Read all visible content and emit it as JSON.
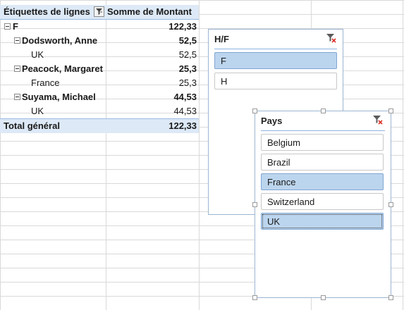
{
  "pivot": {
    "header": {
      "row_labels": "Étiquettes de lignes",
      "sum_label": "Somme de Montant"
    },
    "rows": [
      {
        "label": "F",
        "value": "122,33"
      },
      {
        "label": "Dodsworth, Anne",
        "value": "52,5"
      },
      {
        "label": "UK",
        "value": "52,5"
      },
      {
        "label": "Peacock, Margaret",
        "value": "25,3"
      },
      {
        "label": "France",
        "value": "25,3"
      },
      {
        "label": "Suyama, Michael",
        "value": "44,53"
      },
      {
        "label": "UK",
        "value": "44,53"
      }
    ],
    "total": {
      "label": "Total général",
      "value": "122,33"
    }
  },
  "slicer_hf": {
    "title": "H/F",
    "items": [
      {
        "label": "F",
        "selected": true
      },
      {
        "label": "H",
        "selected": false
      }
    ]
  },
  "slicer_pays": {
    "title": "Pays",
    "items": [
      {
        "label": "Belgium",
        "selected": false
      },
      {
        "label": "Brazil",
        "selected": false
      },
      {
        "label": "France",
        "selected": true
      },
      {
        "label": "Switzerland",
        "selected": false
      },
      {
        "label": "UK",
        "selected": true
      }
    ]
  },
  "colors": {
    "accent": "#dde9f6",
    "selected_item": "#bcd5ee",
    "gridline": "#d9d9d9"
  },
  "icons": {
    "filter": "filter-icon",
    "clear_filter": "clear-filter-icon",
    "collapse": "collapse-icon"
  }
}
